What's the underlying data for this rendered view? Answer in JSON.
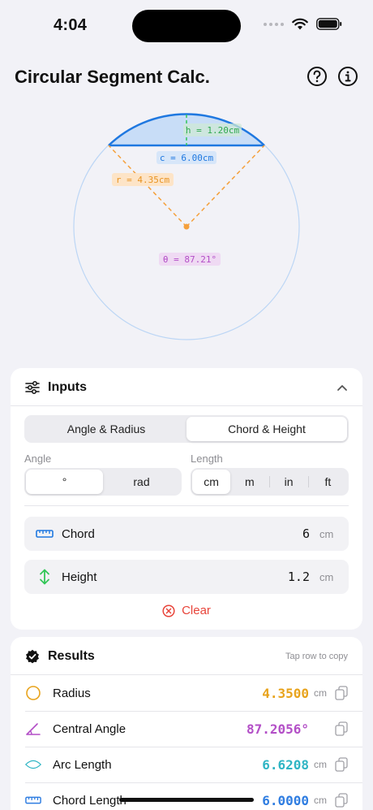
{
  "status": {
    "time": "4:04"
  },
  "header": {
    "title": "Circular Segment Calc."
  },
  "diagram": {
    "height_label": "h = 1.20cm",
    "chord_label": "c = 6.00cm",
    "radius_label": "r = 4.35cm",
    "angle_label": "θ = 87.21°"
  },
  "inputs": {
    "title": "Inputs",
    "mode_tabs": [
      "Angle & Radius",
      "Chord & Height"
    ],
    "angle_label": "Angle",
    "angle_units": [
      "°",
      "rad"
    ],
    "length_label": "Length",
    "length_units": [
      "cm",
      "m",
      "in",
      "ft"
    ],
    "chord": {
      "label": "Chord",
      "value": "6",
      "unit": "cm"
    },
    "height": {
      "label": "Height",
      "value": "1.2",
      "unit": "cm"
    },
    "clear_label": "Clear"
  },
  "results": {
    "title": "Results",
    "hint": "Tap row to copy",
    "rows": [
      {
        "label": "Radius",
        "value": "4.3500",
        "unit": "cm",
        "color": "#e8a31c"
      },
      {
        "label": "Central Angle",
        "value": "87.2056°",
        "unit": "",
        "color": "#b34fc7"
      },
      {
        "label": "Arc Length",
        "value": "6.6208",
        "unit": "cm",
        "color": "#2fb5c4"
      },
      {
        "label": "Chord Length",
        "value": "6.0000",
        "unit": "cm",
        "color": "#2f7de1"
      }
    ]
  },
  "colors": {
    "chord": "#1f78e0",
    "radius": "#f5a03b",
    "height": "#34c759",
    "angle": "#b34fc7",
    "clear": "#e8443a"
  }
}
